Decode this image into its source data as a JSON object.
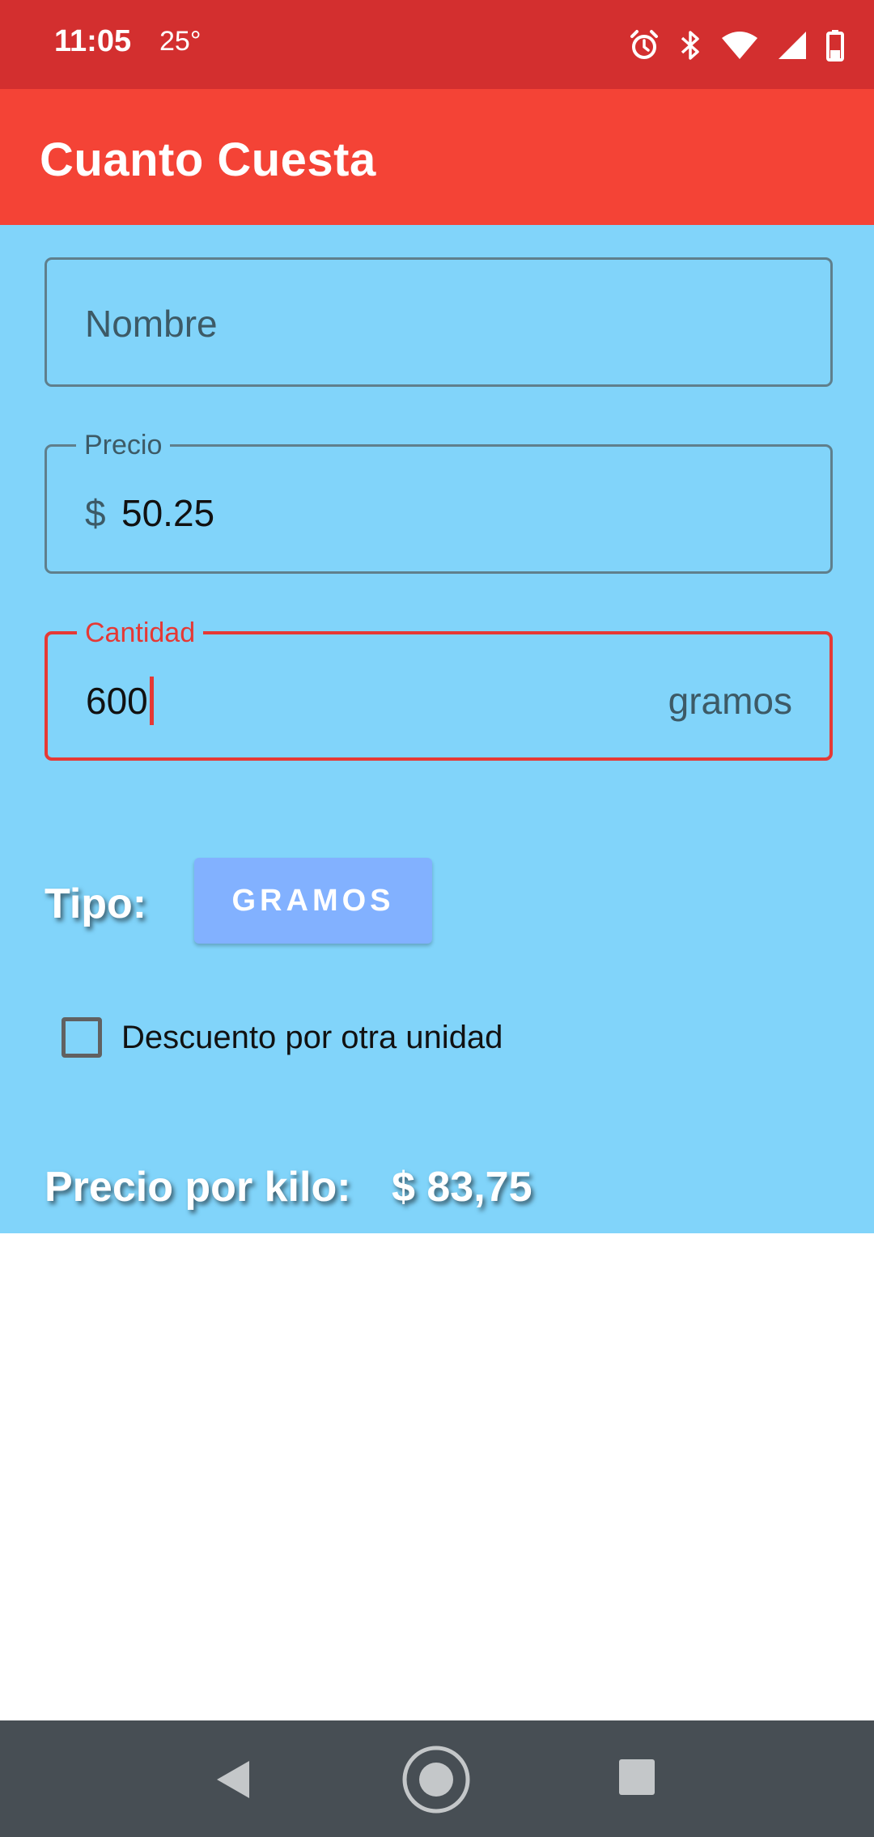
{
  "status_bar": {
    "time": "11:05",
    "temperature": "25°",
    "icons": [
      "alarm-icon",
      "bluetooth-icon",
      "wifi-icon",
      "signal-icon",
      "battery-icon"
    ]
  },
  "app_bar": {
    "title": "Cuanto Cuesta",
    "color": "#f44336"
  },
  "form": {
    "nombre": {
      "placeholder": "Nombre",
      "value": ""
    },
    "precio": {
      "label": "Precio",
      "prefix": "$",
      "value": "50.25"
    },
    "cantidad": {
      "label": "Cantidad",
      "value": "600",
      "suffix": "gramos",
      "focused": true
    }
  },
  "tipo": {
    "label": "Tipo:",
    "button_label": "GRAMOS"
  },
  "descuento": {
    "label": "Descuento por otra unidad",
    "checked": false
  },
  "result": {
    "label": "Precio por kilo:",
    "value": "$ 83,75"
  },
  "nav_bar": {
    "buttons": [
      "back-icon",
      "home-icon",
      "recents-icon"
    ]
  },
  "colors": {
    "status_bar": "#d32f2f",
    "content_background": "#81d4fa",
    "focus": "#e53935",
    "button": "#82b1ff",
    "nav_bar": "#474e54"
  }
}
